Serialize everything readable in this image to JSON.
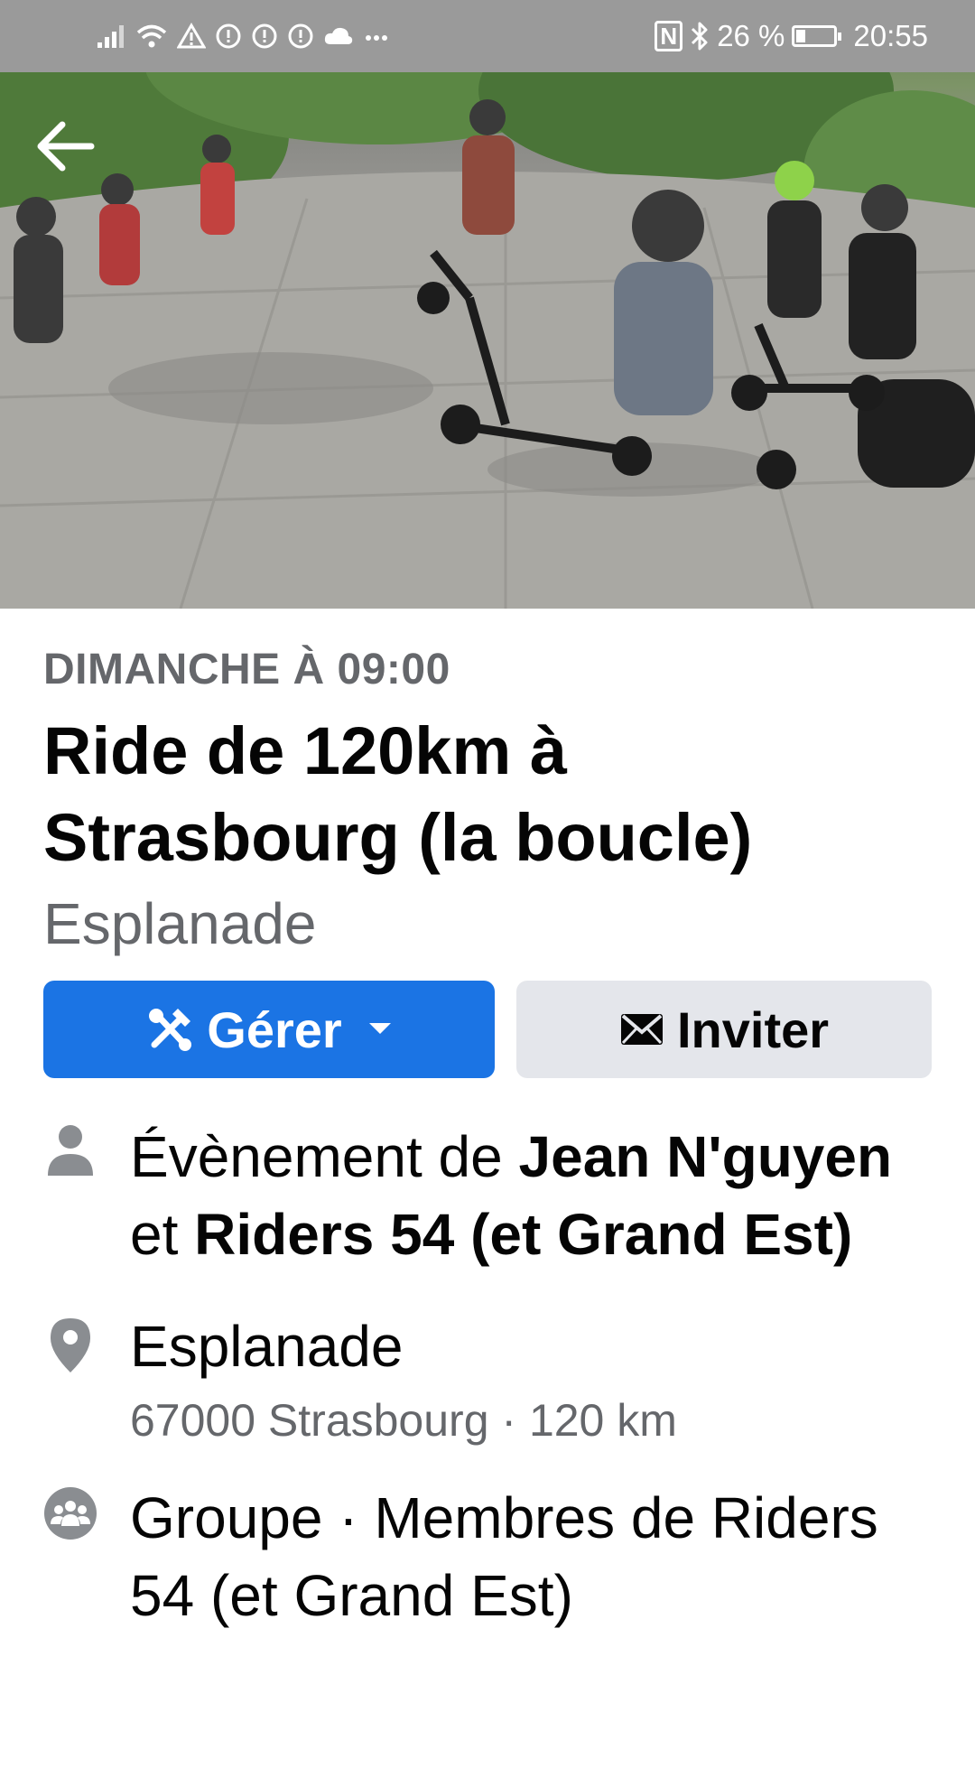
{
  "status_bar": {
    "left_icons": [
      "signal-icon",
      "wifi-icon",
      "warning-icon",
      "alert-icon",
      "alert-icon",
      "alert-icon",
      "cloud-icon",
      "more-icon"
    ],
    "nfc": "N",
    "battery_percent": "26 %",
    "battery_level": 0.26,
    "time": "20:55"
  },
  "event": {
    "date": "DIMANCHE À 09:00",
    "title": "Ride de 120km à Strasbourg (la boucle)",
    "location_short": "Esplanade"
  },
  "actions": {
    "manage_label": "Gérer",
    "invite_label": "Inviter"
  },
  "details": {
    "host_prefix": "Évènement de ",
    "host_name_1": "Jean N'guyen",
    "host_joiner": " et ",
    "host_name_2": "Riders 54 (et Grand Est)",
    "place_name": "Esplanade",
    "place_address": "67000 Strasbourg · 120 km",
    "group_text": "Groupe · Membres de Riders 54 (et Grand Est)"
  },
  "colors": {
    "primary": "#1b74e4",
    "secondary_bg": "#e4e6eb",
    "muted_text": "#65676b",
    "icon_gray": "#8a8d91"
  }
}
